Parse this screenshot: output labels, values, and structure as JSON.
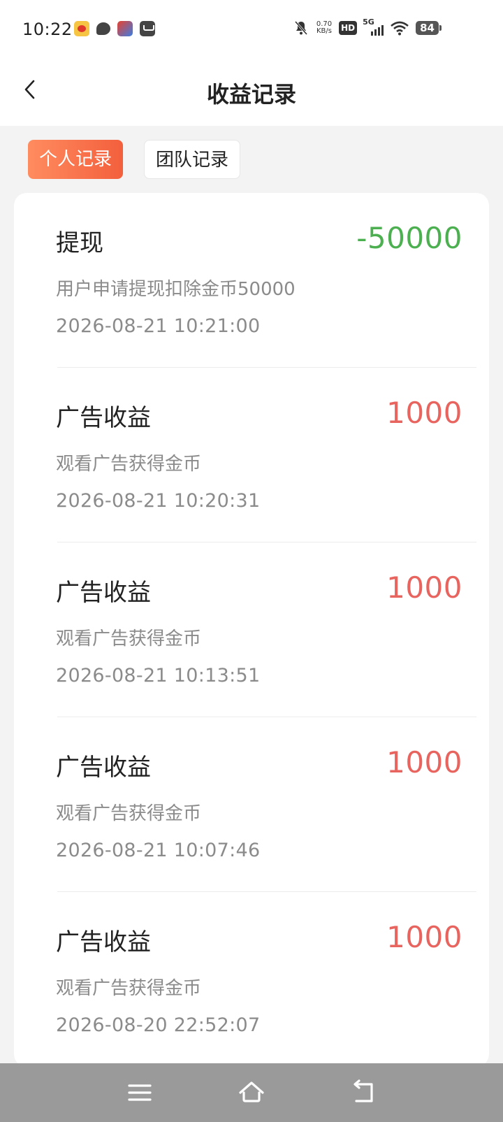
{
  "status_bar": {
    "time": "10:22",
    "net_speed_value": "0.70",
    "net_speed_unit": "KB/s",
    "hd_label": "HD",
    "signal_label": "5G",
    "battery": "84",
    "icons": [
      "weibo-icon",
      "chat-icon",
      "app-icon",
      "mail-icon",
      "mute-icon",
      "wifi-icon"
    ]
  },
  "header": {
    "title": "收益记录",
    "back_icon": "chevron-left-icon"
  },
  "tabs": [
    {
      "label": "个人记录",
      "active": true
    },
    {
      "label": "团队记录",
      "active": false
    }
  ],
  "colors": {
    "accent_start": "#ff8c5f",
    "accent_end": "#f35f3c",
    "negative_amount": "#4caf50",
    "positive_amount": "#e8645f"
  },
  "records": [
    {
      "title": "提现",
      "amount": "-50000",
      "desc": "用户申请提现扣除金币50000",
      "time": "2026-08-21 10:21:00",
      "type": "withdraw"
    },
    {
      "title": "广告收益",
      "amount": "1000",
      "desc": "观看广告获得金币",
      "time": "2026-08-21 10:20:31",
      "type": "income"
    },
    {
      "title": "广告收益",
      "amount": "1000",
      "desc": "观看广告获得金币",
      "time": "2026-08-21 10:13:51",
      "type": "income"
    },
    {
      "title": "广告收益",
      "amount": "1000",
      "desc": "观看广告获得金币",
      "time": "2026-08-21 10:07:46",
      "type": "income"
    },
    {
      "title": "广告收益",
      "amount": "1000",
      "desc": "观看广告获得金币",
      "time": "2026-08-20 22:52:07",
      "type": "income"
    }
  ],
  "nav_bar": {
    "icons": [
      "menu-icon",
      "home-icon",
      "back-icon"
    ]
  }
}
